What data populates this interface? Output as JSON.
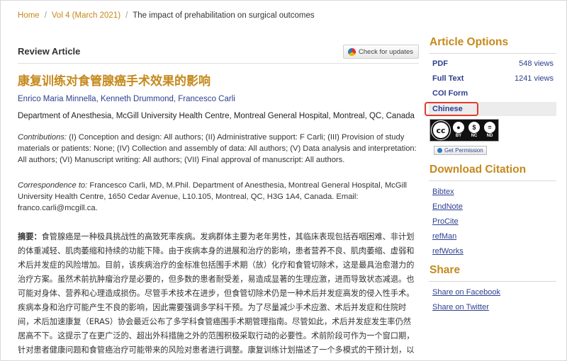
{
  "breadcrumb": {
    "home": "Home",
    "volume": "Vol 4 (March 2021)",
    "current": "The impact of prehabilitation on surgical outcomes"
  },
  "article": {
    "type": "Review Article",
    "check_updates": "Check for updates",
    "title": "康复训练对食管腺癌手术效果的影响",
    "authors": [
      "Enrico Maria Minnella",
      "Kenneth Drummond",
      "Francesco Carli"
    ],
    "affiliation": "Department of Anesthesia, McGill University Health Centre, Montreal General Hospital, Montreal, QC, Canada",
    "contributions_label": "Contributions:",
    "contributions_text": " (I) Conception and design: All authors; (II) Administrative support: F Carli; (III) Provision of study materials or patients: None; (IV) Collection and assembly of data: All authors; (V) Data analysis and interpretation: All authors; (VI) Manuscript writing: All authors; (VII) Final approval of manuscript: All authors.",
    "correspondence_label": "Correspondence to:",
    "correspondence_text": " Francesco Carli, MD, M.Phil. Department of Anesthesia, Montreal General Hospital, McGill University Health Centre, 1650 Cedar Avenue, L10.105, Montreal, QC, H3G 1A4, Canada. Email: franco.carli@mcgill.ca.",
    "abstract_label": "摘要：",
    "abstract_text": "食管腺癌是一种极具挑战性的高致死率疾病。发病群体主要为老年男性，其临床表现包括吞咽困难、非计划的体重减轻、肌肉萎缩和持续的功能下降。由于疾病本身的进展和治疗的影响，患者营养不良、肌肉萎缩、虚弱和术后并发症的风险增加。目前，该疾病治疗的金标准包括围手术期（放）化疗和食管切除术，这是最具治愈潜力的治疗方案。虽然术前抗肿瘤治疗是必要的，但多数的患者耐受差，易造成显著的生理应激，进而导致状态减退。也可能对身体、营养和心理造成损伤。尽管手术技术在进步，但食管切除术仍是一种术后并发症高发的侵入性手术。疾病本身和治疗可能产生不良的影响，因此需要强调多学科干预。为了尽量减少手术应激、术后并发症和住院时间，术后加速康复（ERAS）协会最近公布了多学科食管癌围手术期管理指南。尽管如此，术后并发症发生率仍然居高不下。这提示了在更广泛的、超出外科措施之外的范围积极采取行动的必要性。术前阶段可作为一个窗口期，针对患者健康问题和食管癌治疗可能带来的风险对患者进行调整。康复训练计划描述了一个多模式的干预计划，以"
  },
  "sidebar": {
    "options_title": "Article Options",
    "options": [
      {
        "label": "PDF",
        "views": "548 views"
      },
      {
        "label": "Full Text",
        "views": "1241 views"
      },
      {
        "label": "COI Form",
        "views": ""
      },
      {
        "label": "Chinese",
        "views": ""
      }
    ],
    "license": {
      "cc": "cc",
      "by": "BY",
      "nc": "NC",
      "nd": "ND"
    },
    "get_permission": "Get Permission",
    "citation_title": "Download Citation",
    "citations": [
      "Bibtex",
      "EndNote",
      "ProCite",
      "refMan",
      "refWorks"
    ],
    "share_title": "Share",
    "share": [
      "Share on Facebook",
      "Share on Twitter"
    ]
  },
  "colors": {
    "accent": "#c5891c",
    "link": "#2c3f8f",
    "highlight": "#e13b2e"
  }
}
